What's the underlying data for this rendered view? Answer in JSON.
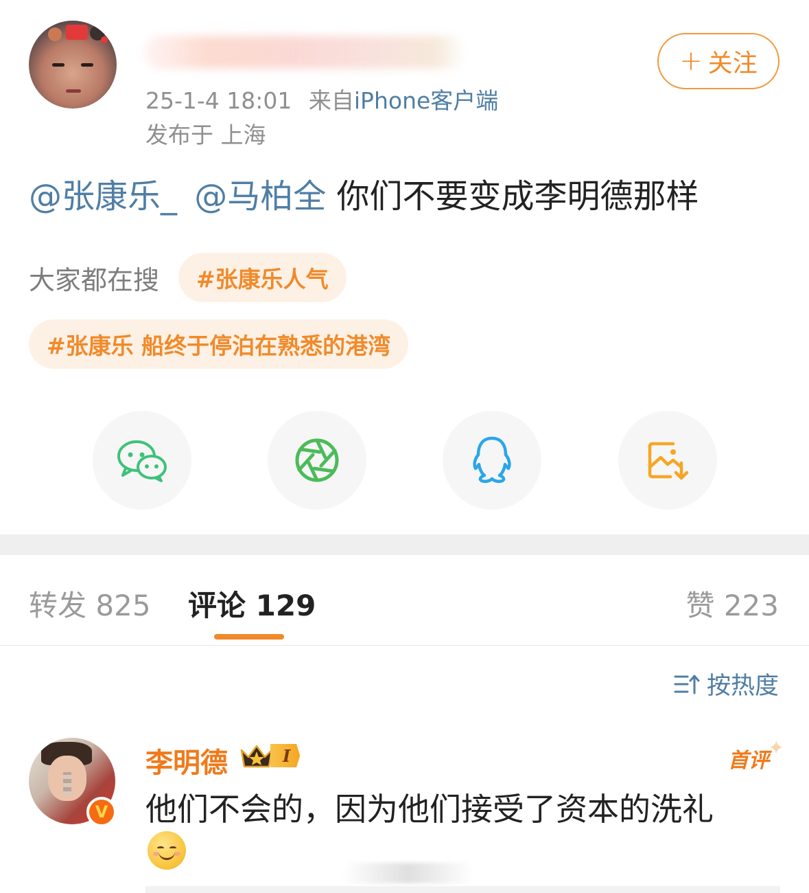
{
  "header": {
    "username": "",
    "time": "25-1-4 18:01",
    "from_prefix": "来自",
    "source": "iPhone客户端",
    "location": "发布于 上海",
    "follow_plus": "+",
    "follow_label": "关注"
  },
  "post": {
    "mention1": "@张康乐_",
    "mention2": "@马柏全",
    "text": " 你们不要变成李明德那样"
  },
  "trending": {
    "label": "大家都在搜",
    "tags": [
      "#张康乐人气",
      "#张康乐 船终于停泊在熟悉的港湾"
    ]
  },
  "share": {
    "items": [
      "wechat-icon",
      "moments-icon",
      "qq-icon",
      "save-image-icon"
    ],
    "colors": {
      "wechat": "#3ec27a",
      "moments": "#4cbb5a",
      "qq": "#2aa6e8",
      "save": "#f5a623"
    }
  },
  "tabs": {
    "repost_label": "转发",
    "repost_count": "825",
    "comment_label": "评论",
    "comment_count": "129",
    "like_label": "赞",
    "like_count": "223"
  },
  "sort": {
    "label": "按热度",
    "icon": "sort-icon"
  },
  "comments": [
    {
      "name": "李明德",
      "level": "I",
      "tag": "首评",
      "text": "他们不会的，因为他们接受了资本的洗礼",
      "emoji": "smile-emoji",
      "verified": "V"
    }
  ],
  "colors": {
    "accent": "#f08a2a",
    "link": "#4f7ea5",
    "muted": "#8f8f8f"
  }
}
